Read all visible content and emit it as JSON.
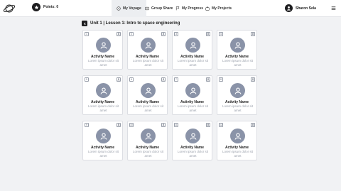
{
  "header": {
    "points_label": "Points: 0",
    "tabs": [
      {
        "label": "My Voyage",
        "icon": "compass-icon",
        "active": true
      },
      {
        "label": "Group Share",
        "icon": "share-icon",
        "active": false
      },
      {
        "label": "My Progress",
        "icon": "flag-icon",
        "active": false
      },
      {
        "label": "My Projects",
        "icon": "briefcase-icon",
        "active": false
      }
    ],
    "user_name": "Sharon Sela"
  },
  "lesson": {
    "title": "Unit 1 | Lesson 1: Intro to space engineering"
  },
  "activities": [
    {
      "number": "1",
      "name": "Activity Name",
      "description": "Lorem ipsum dolor sit amet"
    },
    {
      "number": "2",
      "name": "Activity Name",
      "description": "Lorem ipsum dolor sit amet"
    },
    {
      "number": "3",
      "name": "Activity Name",
      "description": "Lorem ipsum dolor sit amet"
    },
    {
      "number": "4",
      "name": "Activity Name",
      "description": "Lorem ipsum dolor sit amet"
    },
    {
      "number": "5",
      "name": "Activity Name",
      "description": "Lorem ipsum dolor sit amet"
    },
    {
      "number": "6",
      "name": "Activity Name",
      "description": "Lorem ipsum dolor sit amet"
    },
    {
      "number": "7",
      "name": "Activity Name",
      "description": "Lorem ipsum dolor sit amet"
    },
    {
      "number": "8",
      "name": "Activity Name",
      "description": "Lorem ipsum dolor sit amet"
    },
    {
      "number": "9",
      "name": "Activity Name",
      "description": "Lorem ipsum dolor sit amet"
    },
    {
      "number": "10",
      "name": "Activity Name",
      "description": "Lorem ipsum dolor sit amet"
    },
    {
      "number": "11",
      "name": "Activity Name",
      "description": "Lorem ipsum dolor sit amet"
    },
    {
      "number": "12",
      "name": "Activity Name",
      "description": "Lorem ipsum dolor sit amet"
    }
  ],
  "colors": {
    "avatar_bg": "#8a93a8",
    "dark": "#1d1d1f",
    "page_bg": "#f1f2f4"
  }
}
